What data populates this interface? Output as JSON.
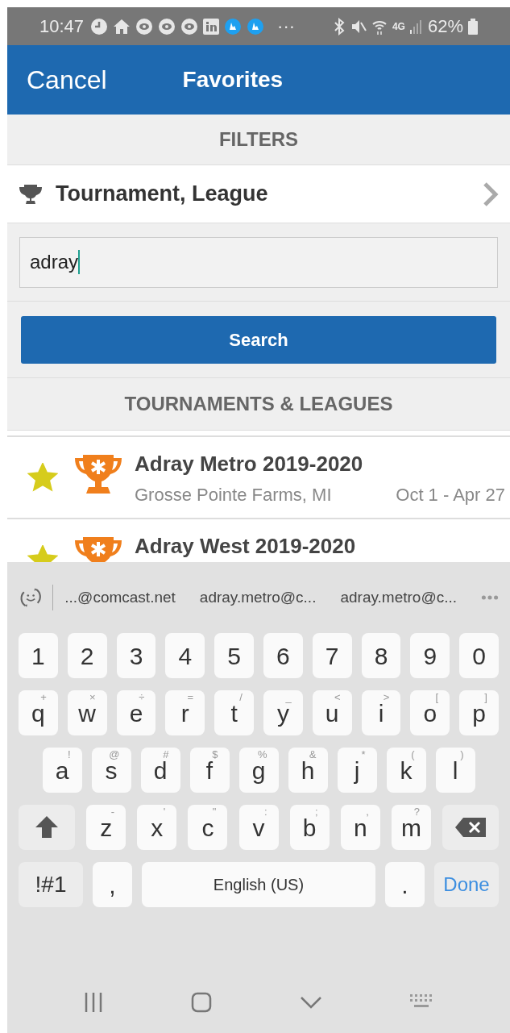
{
  "status_bar": {
    "time": "10:47",
    "more": "···",
    "network": "4G",
    "battery": "62%"
  },
  "header": {
    "cancel": "Cancel",
    "title": "Favorites"
  },
  "filters": {
    "heading": "FILTERS",
    "filter_label": "Tournament, League",
    "search_value": "adray",
    "search_button": "Search"
  },
  "results": {
    "heading": "TOURNAMENTS & LEAGUES",
    "items": [
      {
        "title": "Adray Metro 2019-2020",
        "location": "Grosse Pointe Farms, MI",
        "dates": "Oct 1 - Apr 27",
        "favorite": true
      },
      {
        "title": "Adray West 2019-2020",
        "favorite": true
      }
    ]
  },
  "keyboard": {
    "suggestions": [
      "...@comcast.net",
      "adray.metro@c...",
      "adray.metro@c..."
    ],
    "rows": [
      {
        "keys": [
          {
            "label": "1"
          },
          {
            "label": "2"
          },
          {
            "label": "3"
          },
          {
            "label": "4"
          },
          {
            "label": "5"
          },
          {
            "label": "6"
          },
          {
            "label": "7"
          },
          {
            "label": "8"
          },
          {
            "label": "9"
          },
          {
            "label": "0"
          }
        ]
      },
      {
        "keys": [
          {
            "label": "q",
            "hint": "+"
          },
          {
            "label": "w",
            "hint": "×"
          },
          {
            "label": "e",
            "hint": "÷"
          },
          {
            "label": "r",
            "hint": "="
          },
          {
            "label": "t",
            "hint": "/"
          },
          {
            "label": "y",
            "hint": "_"
          },
          {
            "label": "u",
            "hint": "<"
          },
          {
            "label": "i",
            "hint": ">"
          },
          {
            "label": "o",
            "hint": "["
          },
          {
            "label": "p",
            "hint": "]"
          }
        ]
      },
      {
        "keys": [
          {
            "label": "a",
            "hint": "!"
          },
          {
            "label": "s",
            "hint": "@"
          },
          {
            "label": "d",
            "hint": "#"
          },
          {
            "label": "f",
            "hint": "$"
          },
          {
            "label": "g",
            "hint": "%"
          },
          {
            "label": "h",
            "hint": "&"
          },
          {
            "label": "j",
            "hint": "*"
          },
          {
            "label": "k",
            "hint": "("
          },
          {
            "label": "l",
            "hint": ")"
          }
        ]
      },
      {
        "keys": [
          {
            "kind": "shift"
          },
          {
            "label": "z",
            "hint": "-"
          },
          {
            "label": "x",
            "hint": "'"
          },
          {
            "label": "c",
            "hint": "\""
          },
          {
            "label": "v",
            "hint": ":"
          },
          {
            "label": "b",
            "hint": ";"
          },
          {
            "label": "n",
            "hint": ","
          },
          {
            "label": "m",
            "hint": "?"
          },
          {
            "kind": "backspace"
          }
        ]
      },
      {
        "keys": [
          {
            "label": "!#1",
            "kind": "symbols"
          },
          {
            "label": ","
          },
          {
            "label": "English (US)",
            "kind": "space"
          },
          {
            "label": "."
          },
          {
            "label": "Done",
            "kind": "done"
          }
        ]
      }
    ]
  }
}
